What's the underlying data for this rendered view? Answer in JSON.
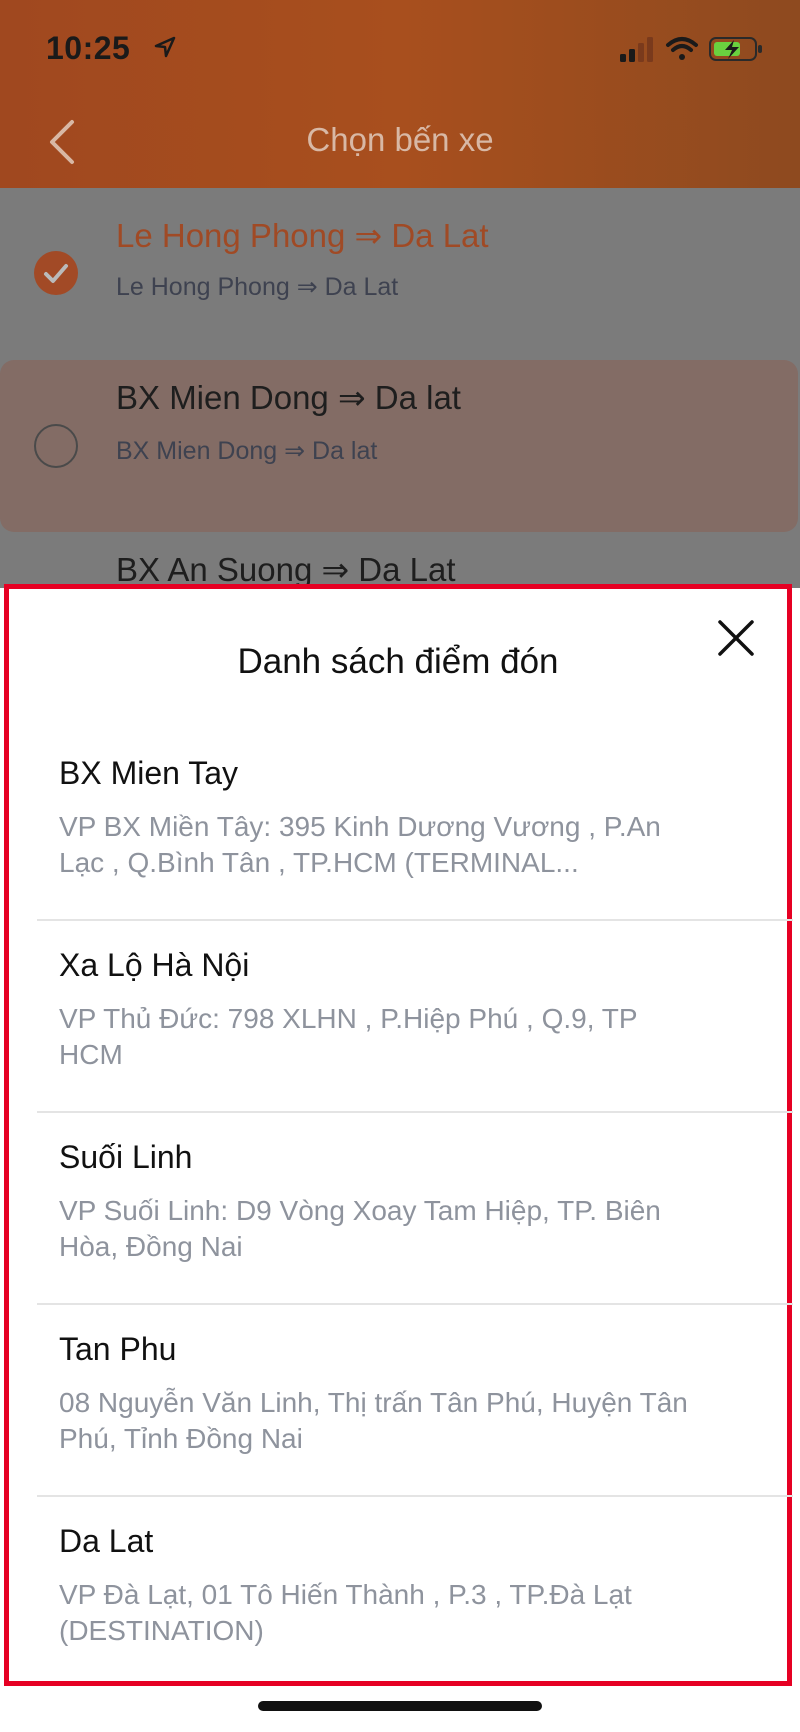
{
  "status": {
    "time": "10:25",
    "icons": [
      "location-arrow-icon",
      "cellular-signal-icon",
      "wifi-icon",
      "battery-charging-icon"
    ]
  },
  "header": {
    "title": "Chọn bến xe",
    "back_icon": "chevron-left-icon",
    "color": "#a84f1e"
  },
  "routes": [
    {
      "title": "Le Hong Phong ⇒ Da Lat",
      "subtitle": "Le Hong Phong ⇒ Da Lat",
      "selected": true
    },
    {
      "title": "BX Mien Dong ⇒ Da lat",
      "subtitle": "BX Mien Dong ⇒ Da lat",
      "selected": false
    },
    {
      "title": "BX An Suong ⇒ Da Lat",
      "subtitle": "",
      "selected": false
    }
  ],
  "sheet": {
    "title": "Danh sách điểm đón",
    "close_icon": "close-icon",
    "items": [
      {
        "name": "BX Mien Tay",
        "address": "VP BX Miền Tây: 395 Kinh Dương Vương , P.An Lạc , Q.Bình Tân , TP.HCM (TERMINAL..."
      },
      {
        "name": "Xa Lộ Hà Nội",
        "address": "VP Thủ Đức: 798 XLHN , P.Hiệp Phú , Q.9, TP HCM"
      },
      {
        "name": "Suối Linh",
        "address": "VP Suối Linh: D9 Vòng Xoay Tam Hiệp, TP. Biên Hòa, Đồng Nai"
      },
      {
        "name": "Tan Phu",
        "address": "08 Nguyễn Văn Linh, Thị trấn Tân Phú, Huyện Tân Phú, Tỉnh Đồng Nai"
      },
      {
        "name": "Da Lat",
        "address": "VP Đà Lạt, 01 Tô Hiến Thành , P.3 , TP.Đà Lạt (DESTINATION)"
      }
    ]
  },
  "colors": {
    "accent": "#a24a26",
    "sheet_border": "#e60023",
    "secondary_text": "#8e939d"
  }
}
